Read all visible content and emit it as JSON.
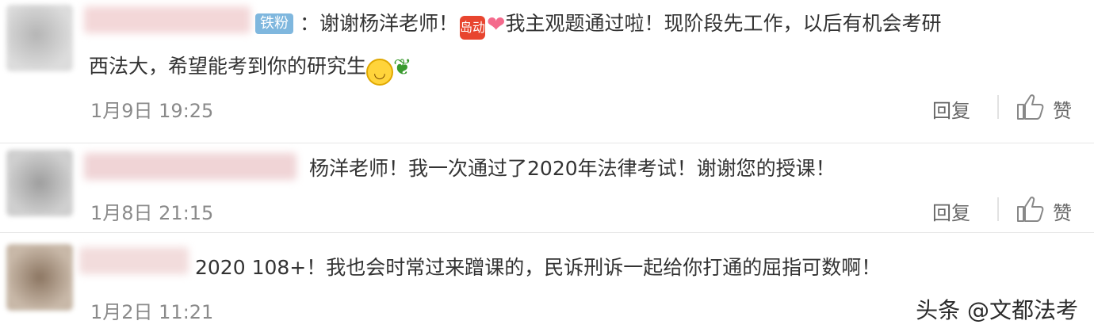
{
  "comments": [
    {
      "badge": "铁粉",
      "text_a": "：谢谢杨洋老师！",
      "emoji_box": "岛动",
      "text_b": "我主观题通过啦！现阶段先工作，以后有机会考研",
      "text_c": "西法大，希望能考到你的研究生",
      "time": "1月9日 19:25",
      "reply_label": "回复",
      "like_label": "赞"
    },
    {
      "text": "杨洋老师！我一次通过了2020年法律考试！谢谢您的授课！",
      "time": "1月8日 21:15",
      "reply_label": "回复",
      "like_label": "赞"
    },
    {
      "text": "2020 108+！我也会时常过来蹭课的，民诉刑诉一起给你打通的屈指可数啊！",
      "time": "1月2日 11:21"
    }
  ],
  "watermark": "头条 @文都法考",
  "icons": [
    "avatar",
    "like-icon",
    "smile-emoji-icon",
    "heart-emoji-icon",
    "leaf-emoji-icon"
  ],
  "colors": {
    "badge": "#7fb7de",
    "time": "#8a8a8a",
    "text": "#333333"
  }
}
